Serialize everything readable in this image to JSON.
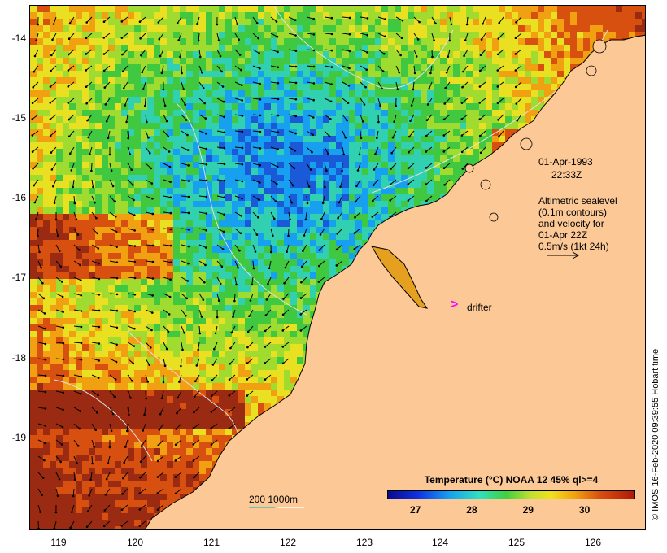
{
  "map": {
    "lat_ticks": [
      "-14",
      "-15",
      "-16",
      "-17",
      "-18",
      "-19"
    ],
    "lon_ticks": [
      "119",
      "120",
      "121",
      "122",
      "123",
      "124",
      "125",
      "126"
    ],
    "lat_range": [
      -20.05,
      -13.6
    ],
    "lon_range": [
      118.7,
      126.6
    ]
  },
  "annotations": {
    "date": "01-Apr-1993",
    "time": "22:33Z",
    "legend_line1": "Altimetric sealevel",
    "legend_line2": "(0.1m contours)",
    "legend_line3": "and velocity for",
    "legend_line4": "01-Apr 22Z",
    "legend_line5": "0.5m/s (1kt 24h)",
    "drifter_label": "drifter",
    "drifter_marker": ">",
    "depth_label": "200  1000m"
  },
  "colorbar": {
    "title": "Temperature (°C) NOAA 12 45% ql>=4",
    "tick_labels": [
      "27",
      "28",
      "29",
      "30"
    ],
    "tick_values": [
      27,
      28,
      29,
      30
    ],
    "range": [
      26.5,
      30.9
    ]
  },
  "credit": "© IMOS 16-Feb-2020 09:39:55 Hobart time",
  "colors": {
    "land": "#fbc896",
    "drifter": "#ff00ff",
    "depth_200": "#40c0c0",
    "depth_1000": "#ffffff"
  }
}
